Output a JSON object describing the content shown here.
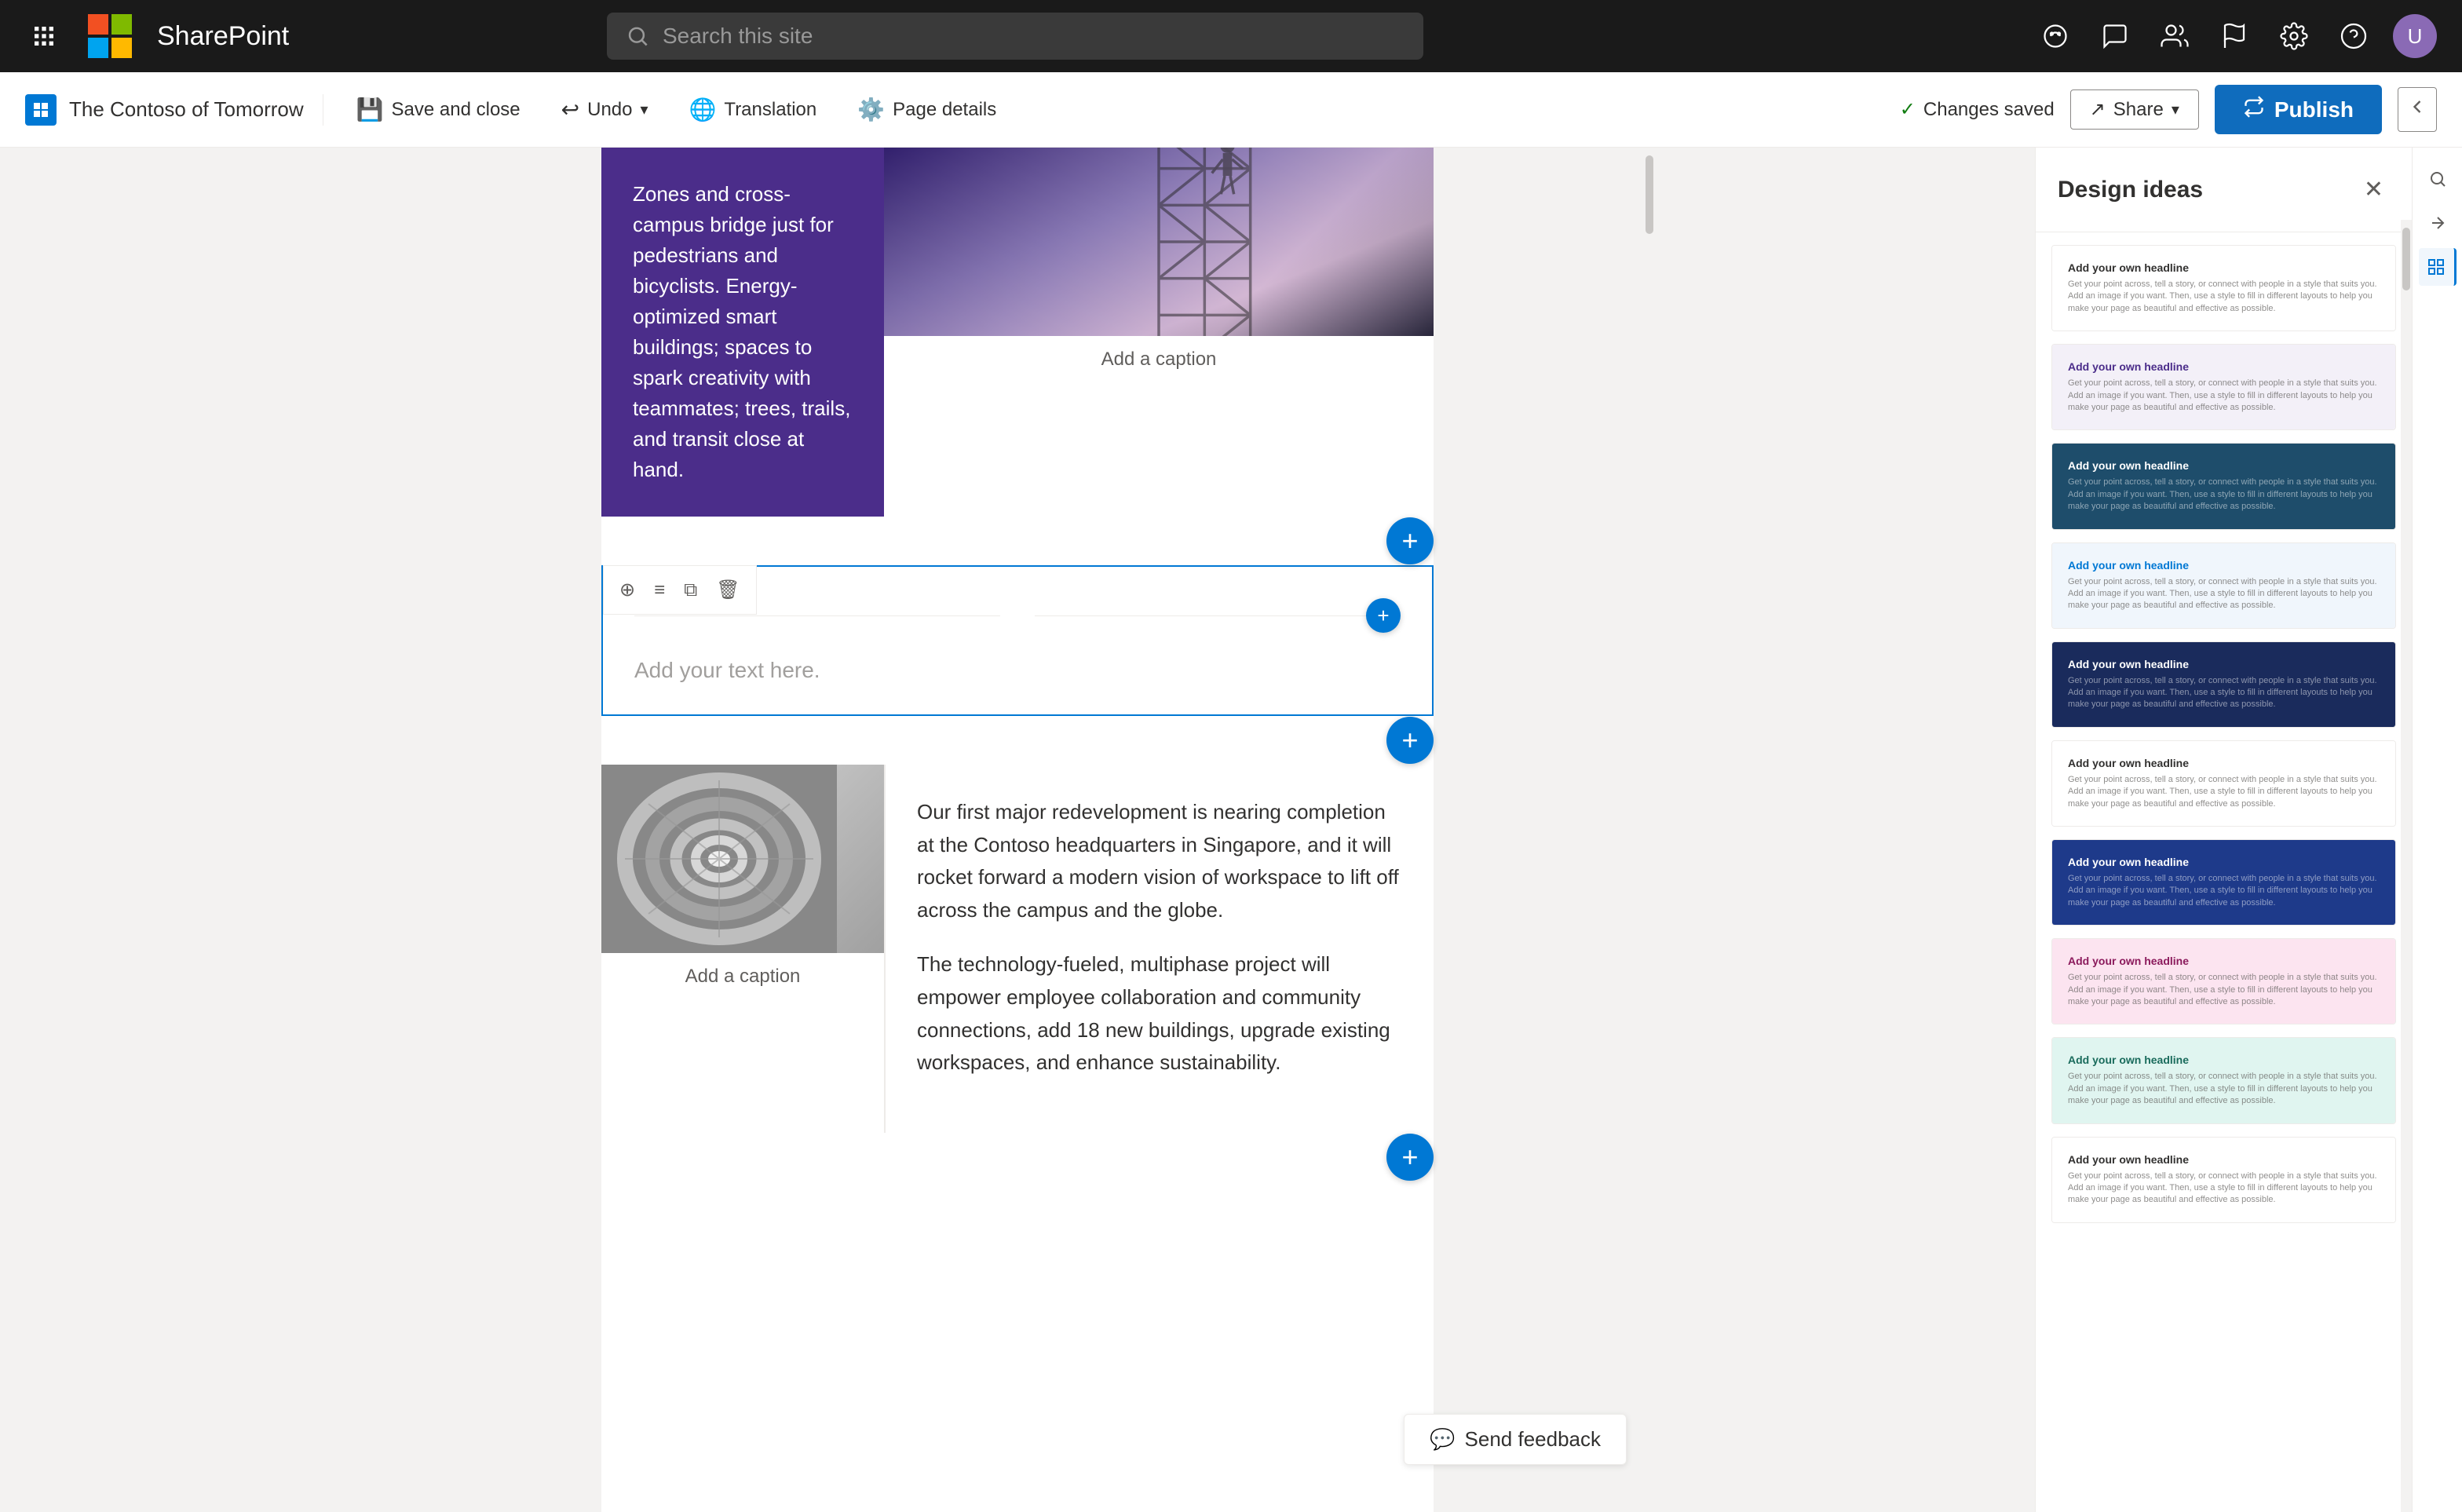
{
  "nav": {
    "brand": "SharePoint",
    "search_placeholder": "Search this site",
    "icons": [
      "copilot",
      "chat",
      "people",
      "flag",
      "settings",
      "help"
    ],
    "avatar_initials": "U"
  },
  "toolbar": {
    "site_name": "The Contoso of Tomorrow",
    "save_close_label": "Save and close",
    "undo_label": "Undo",
    "translation_label": "Translation",
    "page_details_label": "Page details",
    "changes_saved_label": "Changes saved",
    "share_label": "Share",
    "publish_label": "Publish"
  },
  "content": {
    "hero_text": "Zones and cross-campus bridge just for pedestrians and bicyclists. Energy-optimized smart buildings; spaces to spark creativity with teammates; trees, trails, and transit close at hand.",
    "image_caption_1": "Add a caption",
    "text_placeholder": "Add your text here.",
    "image_caption_2": "Add a caption",
    "col_text_1": "Our first major redevelopment is nearing completion at the Contoso headquarters in Singapore, and it will rocket forward a modern vision of workspace to lift off across the campus and the globe.",
    "col_text_2": "The technology-fueled, multiphase project will empower employee collaboration and community connections, add 18 new buildings, upgrade existing workspaces, and enhance sustainability."
  },
  "design_panel": {
    "title": "Design ideas",
    "close_label": "×",
    "cards": [
      {
        "id": 1,
        "theme": "white",
        "headline": "Add your own headline",
        "text": "Get your point across, tell a story, or connect with people in a style that suits you. Add an image if you want. Then, use a style to fill in different layouts to help you make your page as beautiful and effective as possible."
      },
      {
        "id": 2,
        "theme": "light-purple",
        "headline": "Add your own headline",
        "text": "Get your point across, tell a story, or connect with people in a style that suits you. Add an image if you want. Then, use a style to fill in different layouts to help you make your page as beautiful and effective as possible."
      },
      {
        "id": 3,
        "theme": "dark-teal",
        "headline": "Add your own headline",
        "text": "Get your point across, tell a story, or connect with people in a style that suits you. Add an image if you want. Then, use a style to fill in different layouts to help you make your page as beautiful and effective as possible."
      },
      {
        "id": 4,
        "theme": "light-blue",
        "headline": "Add your own headline",
        "text": "Get your point across, tell a story, or connect with people in a style that suits you. Add an image if you want. Then, use a style to fill in different layouts to help you make your page as beautiful and effective as possible."
      },
      {
        "id": 5,
        "theme": "dark-navy",
        "headline": "Add your own headline",
        "text": "Get your point across, tell a story, or connect with people in a style that suits you. Add an image if you want. Then, use a style to fill in different layouts to help you make your page as beautiful and effective as possible."
      },
      {
        "id": 6,
        "theme": "white2",
        "headline": "Add your own headline",
        "text": "Get your point across, tell a story, or connect with people in a style that suits you. Add an image if you want. Then, use a style to fill in different layouts to help you make your page as beautiful and effective as possible."
      },
      {
        "id": 7,
        "theme": "dark-blue",
        "headline": "Add your own headline",
        "text": "Get your point across, tell a story, or connect with people in a style that suits you. Add an image if you want. Then, use a style to fill in different layouts to help you make your page as beautiful and effective as possible."
      },
      {
        "id": 8,
        "theme": "pink",
        "headline": "Add your own headline",
        "text": "Get your point across, tell a story, or connect with people in a style that suits you. Add an image if you want. Then, use a style to fill in different layouts to help you make your page as beautiful and effective as possible."
      },
      {
        "id": 9,
        "theme": "teal-green",
        "headline": "Add your own headline",
        "text": "Get your point across, tell a story, or connect with people in a style that suits you. Add an image if you want. Then, use a style to fill in different layouts to help you make your page as beautiful and effective as possible."
      },
      {
        "id": 10,
        "theme": "white3",
        "headline": "Add your own headline",
        "text": "Get your point across, tell a story, or connect with people in a style that suits you. Add an image if you want. Then, use a style to fill in different layouts to help you make your page as beautiful and effective as possible."
      }
    ]
  },
  "feedback": {
    "label": "Send feedback"
  }
}
